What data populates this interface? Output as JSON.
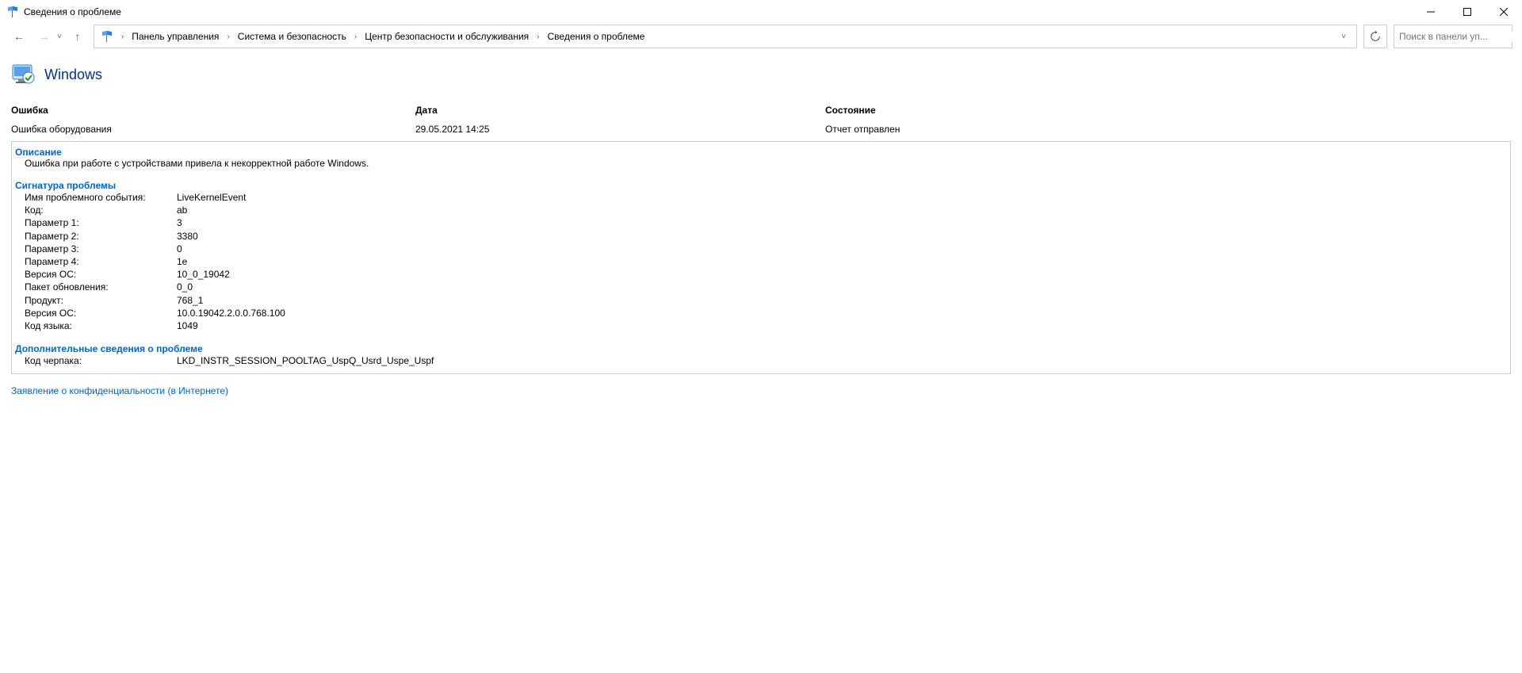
{
  "window": {
    "title": "Сведения о проблеме"
  },
  "breadcrumb": {
    "items": [
      "Панель управления",
      "Система и безопасность",
      "Центр безопасности и обслуживания",
      "Сведения о проблеме"
    ]
  },
  "search": {
    "placeholder": "Поиск в панели уп..."
  },
  "heading": "Windows",
  "columns": {
    "error_label": "Ошибка",
    "error_value": "Ошибка оборудования",
    "date_label": "Дата",
    "date_value": "29.05.2021 14:25",
    "status_label": "Состояние",
    "status_value": "Отчет отправлен"
  },
  "sections": {
    "description_header": "Описание",
    "description_text": "Ошибка при работе с устройствами привела к некорректной работе Windows.",
    "signature_header": "Сигнатура проблемы",
    "signature_rows": [
      {
        "key": "Имя проблемного события:",
        "val": "LiveKernelEvent"
      },
      {
        "key": "Код:",
        "val": "ab"
      },
      {
        "key": "Параметр 1:",
        "val": "3"
      },
      {
        "key": "Параметр 2:",
        "val": "3380"
      },
      {
        "key": "Параметр 3:",
        "val": "0"
      },
      {
        "key": "Параметр 4:",
        "val": "1e"
      },
      {
        "key": "Версия ОС:",
        "val": "10_0_19042"
      },
      {
        "key": "Пакет обновления:",
        "val": "0_0"
      },
      {
        "key": "Продукт:",
        "val": "768_1"
      },
      {
        "key": "Версия ОС:",
        "val": "10.0.19042.2.0.0.768.100"
      },
      {
        "key": "Код языка:",
        "val": "1049"
      }
    ],
    "extra_header": "Дополнительные сведения о проблеме",
    "extra_rows": [
      {
        "key": "Код черпака:",
        "val": "LKD_INSTR_SESSION_POOLTAG_UspQ_Usrd_Uspe_Uspf"
      }
    ]
  },
  "privacy_link": "Заявление о конфиденциальности (в Интернете)"
}
